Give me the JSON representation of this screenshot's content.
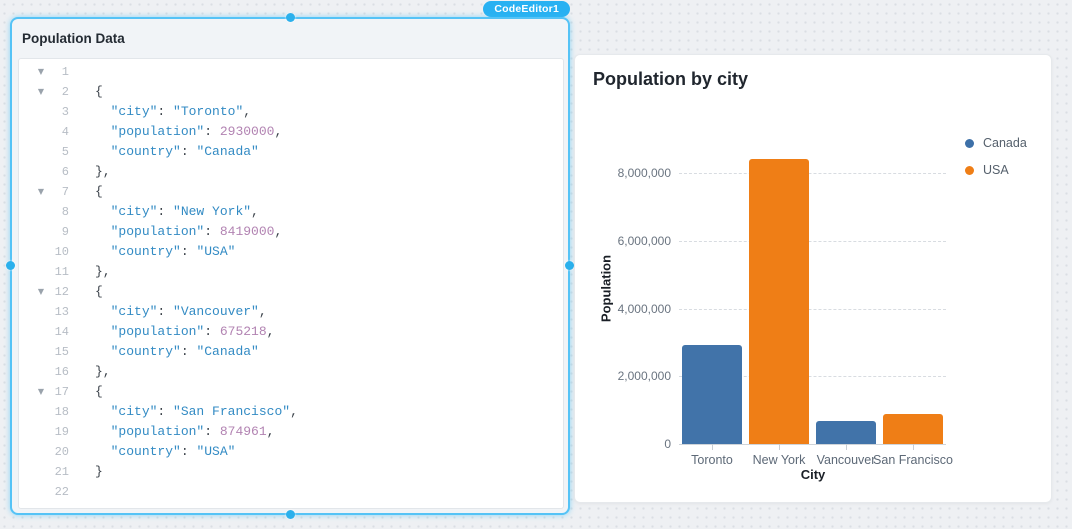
{
  "app": {
    "selected_widget_tag": "CodeEditor1"
  },
  "editor": {
    "title": "Population Data",
    "lines": [
      {
        "n": "1",
        "fold": true,
        "seg": []
      },
      {
        "n": "2",
        "fold": true,
        "seg": [
          {
            "t": "{",
            "c": "p"
          }
        ]
      },
      {
        "n": "3",
        "seg": [
          {
            "t": "  ",
            "c": "p"
          },
          {
            "t": "\"city\"",
            "c": "s"
          },
          {
            "t": ": ",
            "c": "p"
          },
          {
            "t": "\"Toronto\"",
            "c": "s"
          },
          {
            "t": ",",
            "c": "p"
          }
        ]
      },
      {
        "n": "4",
        "seg": [
          {
            "t": "  ",
            "c": "p"
          },
          {
            "t": "\"population\"",
            "c": "s"
          },
          {
            "t": ": ",
            "c": "p"
          },
          {
            "t": "2930000",
            "c": "n"
          },
          {
            "t": ",",
            "c": "p"
          }
        ]
      },
      {
        "n": "5",
        "seg": [
          {
            "t": "  ",
            "c": "p"
          },
          {
            "t": "\"country\"",
            "c": "s"
          },
          {
            "t": ": ",
            "c": "p"
          },
          {
            "t": "\"Canada\"",
            "c": "s"
          }
        ]
      },
      {
        "n": "6",
        "seg": [
          {
            "t": "},",
            "c": "p"
          }
        ]
      },
      {
        "n": "7",
        "fold": true,
        "seg": [
          {
            "t": "{",
            "c": "p"
          }
        ]
      },
      {
        "n": "8",
        "seg": [
          {
            "t": "  ",
            "c": "p"
          },
          {
            "t": "\"city\"",
            "c": "s"
          },
          {
            "t": ": ",
            "c": "p"
          },
          {
            "t": "\"New York\"",
            "c": "s"
          },
          {
            "t": ",",
            "c": "p"
          }
        ]
      },
      {
        "n": "9",
        "seg": [
          {
            "t": "  ",
            "c": "p"
          },
          {
            "t": "\"population\"",
            "c": "s"
          },
          {
            "t": ": ",
            "c": "p"
          },
          {
            "t": "8419000",
            "c": "n"
          },
          {
            "t": ",",
            "c": "p"
          }
        ]
      },
      {
        "n": "10",
        "seg": [
          {
            "t": "  ",
            "c": "p"
          },
          {
            "t": "\"country\"",
            "c": "s"
          },
          {
            "t": ": ",
            "c": "p"
          },
          {
            "t": "\"USA\"",
            "c": "s"
          }
        ]
      },
      {
        "n": "11",
        "seg": [
          {
            "t": "},",
            "c": "p"
          }
        ]
      },
      {
        "n": "12",
        "fold": true,
        "seg": [
          {
            "t": "{",
            "c": "p"
          }
        ]
      },
      {
        "n": "13",
        "seg": [
          {
            "t": "  ",
            "c": "p"
          },
          {
            "t": "\"city\"",
            "c": "s"
          },
          {
            "t": ": ",
            "c": "p"
          },
          {
            "t": "\"Vancouver\"",
            "c": "s"
          },
          {
            "t": ",",
            "c": "p"
          }
        ]
      },
      {
        "n": "14",
        "seg": [
          {
            "t": "  ",
            "c": "p"
          },
          {
            "t": "\"population\"",
            "c": "s"
          },
          {
            "t": ": ",
            "c": "p"
          },
          {
            "t": "675218",
            "c": "n"
          },
          {
            "t": ",",
            "c": "p"
          }
        ]
      },
      {
        "n": "15",
        "seg": [
          {
            "t": "  ",
            "c": "p"
          },
          {
            "t": "\"country\"",
            "c": "s"
          },
          {
            "t": ": ",
            "c": "p"
          },
          {
            "t": "\"Canada\"",
            "c": "s"
          }
        ]
      },
      {
        "n": "16",
        "seg": [
          {
            "t": "},",
            "c": "p"
          }
        ]
      },
      {
        "n": "17",
        "fold": true,
        "seg": [
          {
            "t": "{",
            "c": "p"
          }
        ]
      },
      {
        "n": "18",
        "seg": [
          {
            "t": "  ",
            "c": "p"
          },
          {
            "t": "\"city\"",
            "c": "s"
          },
          {
            "t": ": ",
            "c": "p"
          },
          {
            "t": "\"San Francisco\"",
            "c": "s"
          },
          {
            "t": ",",
            "c": "p"
          }
        ]
      },
      {
        "n": "19",
        "seg": [
          {
            "t": "  ",
            "c": "p"
          },
          {
            "t": "\"population\"",
            "c": "s"
          },
          {
            "t": ": ",
            "c": "p"
          },
          {
            "t": "874961",
            "c": "n"
          },
          {
            "t": ",",
            "c": "p"
          }
        ]
      },
      {
        "n": "20",
        "seg": [
          {
            "t": "  ",
            "c": "p"
          },
          {
            "t": "\"country\"",
            "c": "s"
          },
          {
            "t": ": ",
            "c": "p"
          },
          {
            "t": "\"USA\"",
            "c": "s"
          }
        ]
      },
      {
        "n": "21",
        "seg": [
          {
            "t": "}",
            "c": "p"
          }
        ]
      },
      {
        "n": "22",
        "seg": []
      }
    ]
  },
  "chart": {
    "title": "Population by city",
    "xlabel": "City",
    "ylabel": "Population",
    "legend": [
      {
        "label": "Canada",
        "color": "#3d70a8"
      },
      {
        "label": "USA",
        "color": "#ef7e16"
      }
    ]
  },
  "chart_data": {
    "type": "bar",
    "title": "Population by city",
    "xlabel": "City",
    "ylabel": "Population",
    "categories": [
      "Toronto",
      "New York",
      "Vancouver",
      "San Francisco"
    ],
    "series": [
      {
        "name": "Canada",
        "color": "#4173a9",
        "values": [
          2930000,
          null,
          675218,
          null
        ]
      },
      {
        "name": "USA",
        "color": "#ef7e16",
        "values": [
          null,
          8419000,
          null,
          874961
        ]
      }
    ],
    "ylim": [
      0,
      8800000
    ],
    "yticks": [
      0,
      2000000,
      4000000,
      6000000,
      8000000
    ],
    "ytick_labels": [
      "0",
      "2,000,000",
      "4,000,000",
      "6,000,000",
      "8,000,000"
    ],
    "grid": "horizontal-dashed",
    "legend_position": "top-right"
  },
  "colors": {
    "selection_accent": "#55c3f6",
    "pill_bg": "#28b1f2",
    "canvas_bg": "#eef0f3",
    "code_string": "#338bc4",
    "code_number": "#b283b2",
    "code_punct": "#3c434b"
  }
}
